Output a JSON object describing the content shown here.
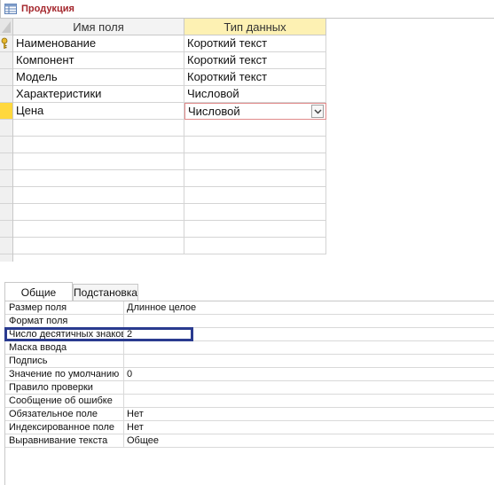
{
  "document_tab": {
    "title": "Продукция",
    "icon": "table-icon"
  },
  "grid": {
    "headers": {
      "name": "Имя поля",
      "type": "Тип данных"
    },
    "rows": [
      {
        "name": "Наименование",
        "type": "Короткий текст",
        "primary_key": true
      },
      {
        "name": "Компонент",
        "type": "Короткий текст"
      },
      {
        "name": "Модель",
        "type": "Короткий текст"
      },
      {
        "name": "Характеристики",
        "type": "Числовой"
      },
      {
        "name": "Цена",
        "type": "Числовой",
        "current": true
      }
    ]
  },
  "properties": {
    "tabs": [
      "Общие",
      "Подстановка"
    ],
    "active_tab": "Общие",
    "rows": [
      {
        "label": "Размер поля",
        "value": "Длинное целое"
      },
      {
        "label": "Формат поля",
        "value": ""
      },
      {
        "label": "Число десятичных знаков",
        "value": "2",
        "highlighted": true
      },
      {
        "label": "Маска ввода",
        "value": ""
      },
      {
        "label": "Подпись",
        "value": ""
      },
      {
        "label": "Значение по умолчанию",
        "value": "0"
      },
      {
        "label": "Правило проверки",
        "value": ""
      },
      {
        "label": "Сообщение об ошибке",
        "value": ""
      },
      {
        "label": "Обязательное поле",
        "value": "Нет"
      },
      {
        "label": "Индексированное поле",
        "value": "Нет"
      },
      {
        "label": "Выравнивание текста",
        "value": "Общее"
      }
    ]
  },
  "colors": {
    "tab_title": "#a4262c",
    "current_row": "#ffd83d",
    "type_header": "#fdf1b3",
    "highlight_box": "#2a3b8f"
  }
}
